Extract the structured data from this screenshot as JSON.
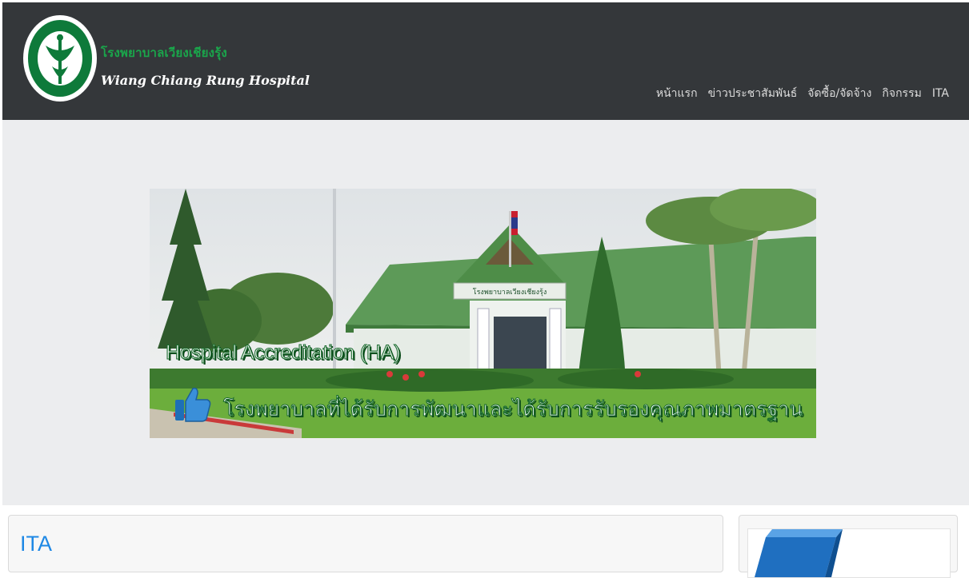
{
  "header": {
    "brand_thai": "โรงพยาบาลเวียงเชียงรุ้ง",
    "brand_en": "Wiang Chiang Rung Hospital",
    "nav": [
      {
        "label": "หน้าแรก"
      },
      {
        "label": "ข่าวประชาสัมพันธ์"
      },
      {
        "label": "จัดซื้อ/จัดจ้าง"
      },
      {
        "label": "กิจกรรม"
      },
      {
        "label": "ITA"
      }
    ]
  },
  "banner": {
    "sign_text": "โรงพยาบาลเวียงเชียงรุ้ง",
    "title": "Hospital Accreditation (HA)",
    "caption": "โรงพยาบาลที่ได้รับการพัฒนาและได้รับการรับรองคุณภาพมาตรฐาน"
  },
  "content": {
    "section_title": "ITA"
  },
  "colors": {
    "topbar": "#34373a",
    "brand_green": "#1aa64b",
    "accent_blue": "#1e88e5",
    "hero_bg": "#ecedef"
  },
  "icons": {
    "logo": "ministry-of-public-health-emblem",
    "thumb": "thumbs-up-icon"
  }
}
